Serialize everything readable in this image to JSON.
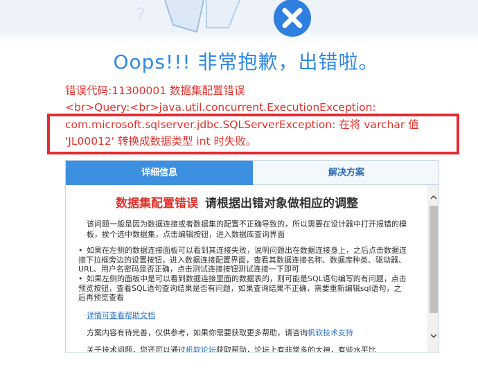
{
  "header": {
    "title": "Oops!!! 非常抱歉，出错啦。"
  },
  "error": {
    "line1": "错误代码:11300001 数据集配置错误",
    "line2": "<br>Query:<br>java.util.concurrent.ExecutionException:",
    "line3": "com.microsoft.sqlserver.jdbc.SQLServerException: 在将 varchar 值",
    "line4": "'JL00012' 转换成数据类型 int 时失败。"
  },
  "tabs": [
    {
      "label": "详细信息"
    },
    {
      "label": "解决方案"
    }
  ],
  "detail": {
    "heading_red": "数据集配置错误",
    "heading_dark": "请根据出错对象做相应的调整",
    "intro": "该问题一般是因为数据连接或者数据集的配置不正确导致的，所以需要在设计器中打开报错的模板，挨个选中数据集，点击编辑按钮，进入数据库查询界面",
    "bullet1": "如果在左侧的数据连接面板可以看到其连接失败，说明问题出在数据连接身上，之后点击数据连接下拉框旁边的设置按钮，进入数据连接配置界面，查看其数据连接名称、数据库种类、驱动器、URL、用户名密码是否正确，点击测试连接按钮测试连接一下即可",
    "bullet2": "如果左侧的面板中是可以看到数据连接里面的数据表的，则可能是SQL语句编写的有问题，点击预览按钮，查看SQL语句查询结果是否有问题，如果查询结果不正确，需要重新编辑sql语句，之后再预览查看",
    "help_link": "详情可查看帮助文档",
    "support_text": "方案内容有待完善，仅供参考，如果你需要获取更多帮助，请咨询",
    "support_link": "帆软技术支持",
    "more_text_a": "关于技术问题，您还可以通过",
    "more_link": "帆软论坛",
    "more_text_b": "获取帮助，论坛上有非常多的大神，有些水平比"
  },
  "colors": {
    "title_blue": "#2f8ae4",
    "error_red": "#e0322c",
    "highlight_box": "#e52b33",
    "tab_active": "#3d8fe0"
  },
  "icons": {
    "error_badge": "close-icon",
    "scroll_up": "chevron-up-icon",
    "scroll_down": "chevron-down-icon"
  }
}
